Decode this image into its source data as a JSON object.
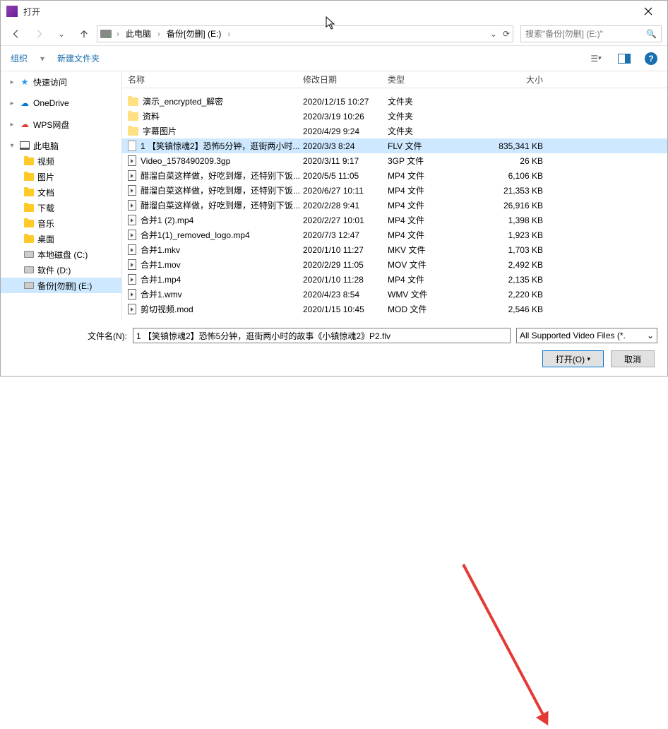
{
  "titlebar": {
    "title": "打开"
  },
  "breadcrumb": {
    "root": "此电脑",
    "folder": "备份[勿删] (E:)"
  },
  "search": {
    "placeholder": "搜索\"备份[勿删] (E:)\""
  },
  "toolbar": {
    "organize": "组织",
    "newfolder": "新建文件夹"
  },
  "headers": {
    "name": "名称",
    "date": "修改日期",
    "type": "类型",
    "size": "大小"
  },
  "sidebar": [
    {
      "label": "快速访问",
      "icon": "star",
      "exp": "▸"
    },
    {
      "label": "OneDrive",
      "icon": "onedrive",
      "exp": "▸"
    },
    {
      "label": "WPS网盘",
      "icon": "wps",
      "exp": "▸"
    },
    {
      "label": "此电脑",
      "icon": "pc",
      "exp": "▾",
      "selected": false
    },
    {
      "label": "视频",
      "icon": "folder",
      "sub": true
    },
    {
      "label": "图片",
      "icon": "folder",
      "sub": true
    },
    {
      "label": "文档",
      "icon": "folder",
      "sub": true
    },
    {
      "label": "下载",
      "icon": "folder",
      "sub": true
    },
    {
      "label": "音乐",
      "icon": "folder",
      "sub": true
    },
    {
      "label": "桌面",
      "icon": "folder",
      "sub": true
    },
    {
      "label": "本地磁盘 (C:)",
      "icon": "drive",
      "sub": true
    },
    {
      "label": "软件 (D:)",
      "icon": "drive",
      "sub": true
    },
    {
      "label": "备份[勿删] (E:)",
      "icon": "drive",
      "sub": true,
      "selected": true
    }
  ],
  "files": [
    {
      "icon": "folder",
      "name": "演示_encrypted_解密",
      "date": "2020/12/15 10:27",
      "type": "文件夹",
      "size": ""
    },
    {
      "icon": "folder",
      "name": "资料",
      "date": "2020/3/19 10:26",
      "type": "文件夹",
      "size": ""
    },
    {
      "icon": "folder",
      "name": "字幕图片",
      "date": "2020/4/29 9:24",
      "type": "文件夹",
      "size": ""
    },
    {
      "icon": "file",
      "name": "1 【笑镇惊魂2】恐怖5分钟，逛街两小时...",
      "date": "2020/3/3 8:24",
      "type": "FLV 文件",
      "size": "835,341 KB",
      "selected": true
    },
    {
      "icon": "video",
      "name": "Video_1578490209.3gp",
      "date": "2020/3/11 9:17",
      "type": "3GP 文件",
      "size": "26 KB"
    },
    {
      "icon": "video",
      "name": "醋溜白菜这样做，好吃到爆，还特别下饭...",
      "date": "2020/5/5 11:05",
      "type": "MP4 文件",
      "size": "6,106 KB"
    },
    {
      "icon": "video",
      "name": "醋溜白菜这样做，好吃到爆，还特别下饭...",
      "date": "2020/6/27 10:11",
      "type": "MP4 文件",
      "size": "21,353 KB"
    },
    {
      "icon": "video",
      "name": "醋溜白菜这样做，好吃到爆，还特别下饭...",
      "date": "2020/2/28 9:41",
      "type": "MP4 文件",
      "size": "26,916 KB"
    },
    {
      "icon": "video",
      "name": "合并1 (2).mp4",
      "date": "2020/2/27 10:01",
      "type": "MP4 文件",
      "size": "1,398 KB"
    },
    {
      "icon": "video",
      "name": "合并1(1)_removed_logo.mp4",
      "date": "2020/7/3 12:47",
      "type": "MP4 文件",
      "size": "1,923 KB"
    },
    {
      "icon": "video",
      "name": "合并1.mkv",
      "date": "2020/1/10 11:27",
      "type": "MKV 文件",
      "size": "1,703 KB"
    },
    {
      "icon": "video",
      "name": "合并1.mov",
      "date": "2020/2/29 11:05",
      "type": "MOV 文件",
      "size": "2,492 KB"
    },
    {
      "icon": "video",
      "name": "合并1.mp4",
      "date": "2020/1/10 11:28",
      "type": "MP4 文件",
      "size": "2,135 KB"
    },
    {
      "icon": "video",
      "name": "合并1.wmv",
      "date": "2020/4/23 8:54",
      "type": "WMV 文件",
      "size": "2,220 KB"
    },
    {
      "icon": "video",
      "name": "剪切视频.mod",
      "date": "2020/1/15 10:45",
      "type": "MOD 文件",
      "size": "2,546 KB"
    }
  ],
  "footer": {
    "label": "文件名(N):",
    "value": "1 【笑镇惊魂2】恐怖5分钟，逛街两小时的故事《小镇惊魂2》P2.flv",
    "filter": "All Supported Video Files (*.",
    "open": "打开(O)",
    "cancel": "取消"
  }
}
